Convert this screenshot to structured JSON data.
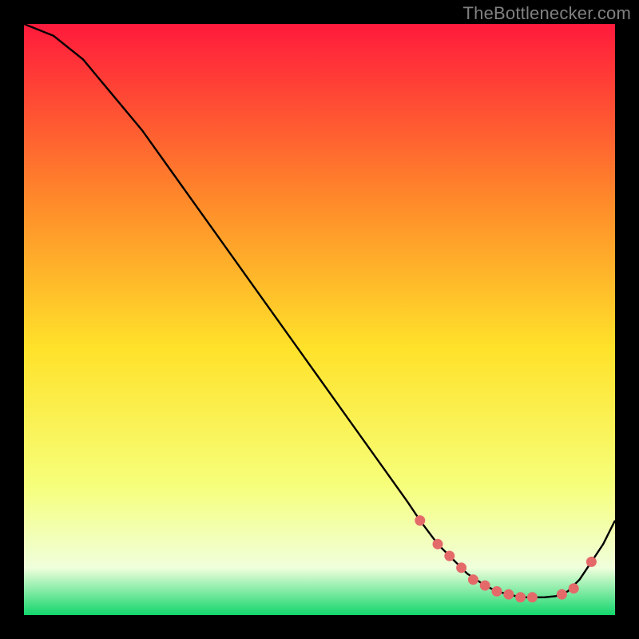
{
  "watermark": "TheBottlenecker.com",
  "colors": {
    "background": "#000000",
    "gradient_top": "#ff1a3c",
    "gradient_mid_upper": "#ff8a2a",
    "gradient_mid": "#ffe22a",
    "gradient_mid_lower": "#f6ff7a",
    "gradient_low_pale": "#f0ffdc",
    "gradient_bottom": "#12d66c",
    "curve": "#000000",
    "marker_fill": "#e46a6a",
    "marker_stroke": "#e46a6a"
  },
  "chart_data": {
    "type": "line",
    "title": "",
    "xlabel": "",
    "ylabel": "",
    "xlim": [
      0,
      100
    ],
    "ylim": [
      0,
      100
    ],
    "series": [
      {
        "name": "bottleneck-curve",
        "x": [
          0,
          5,
          10,
          15,
          20,
          25,
          30,
          35,
          40,
          45,
          50,
          55,
          60,
          65,
          67,
          70,
          72,
          75,
          78,
          80,
          82,
          84,
          86,
          88,
          90,
          92,
          94,
          96,
          98,
          100
        ],
        "y": [
          100,
          98,
          94,
          88,
          82,
          75,
          68,
          61,
          54,
          47,
          40,
          33,
          26,
          19,
          16,
          12,
          10,
          7,
          5,
          4,
          3.5,
          3,
          3,
          3,
          3.2,
          4,
          6,
          9,
          12,
          16
        ]
      }
    ],
    "markers": {
      "name": "bottleneck-markers",
      "x": [
        67,
        70,
        72,
        74,
        76,
        78,
        80,
        82,
        84,
        86,
        91,
        93,
        96
      ],
      "y": [
        16,
        12,
        10,
        8,
        6,
        5,
        4,
        3.5,
        3,
        3,
        3.5,
        4.5,
        9
      ]
    }
  }
}
